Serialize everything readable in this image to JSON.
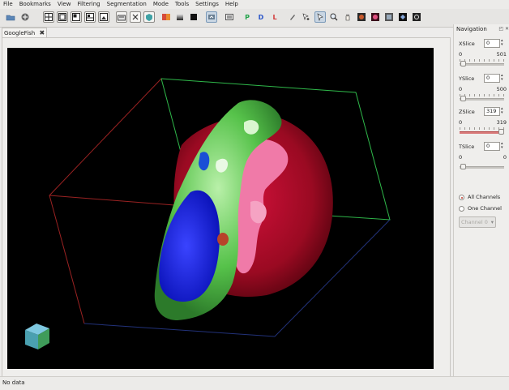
{
  "menu": [
    "File",
    "Bookmarks",
    "View",
    "Filtering",
    "Segmentation",
    "Mode",
    "Tools",
    "Settings",
    "Help"
  ],
  "toolbar": {
    "icons": [
      "open-icon",
      "save-icon",
      "layout-1-icon",
      "layout-2-icon",
      "layout-3-icon",
      "layout-4-icon",
      "screenshot-icon",
      "scissors-icon",
      "shield-icon",
      "color-icon",
      "gradient-icon",
      "black-square-icon",
      "view-3d-icon",
      "view-slice-icon",
      "p-icon",
      "d-icon",
      "l-icon",
      "pen-icon",
      "pointer-plus-icon",
      "pointer-icon",
      "zoom-icon",
      "hand-icon",
      "plugin-1-icon",
      "plugin-2-icon",
      "plugin-3-icon",
      "plugin-4-icon"
    ],
    "p_label": "P",
    "d_label": "D",
    "l_label": "L"
  },
  "tab": {
    "label": "GoogleFish",
    "close": "✖"
  },
  "navigation": {
    "title": "Navigation",
    "xslice": {
      "label": "XSlice",
      "value": "0",
      "min": "0",
      "max": "501"
    },
    "yslice": {
      "label": "YSlice",
      "value": "0",
      "min": "0",
      "max": "500"
    },
    "zslice": {
      "label": "ZSlice",
      "value": "319",
      "min": "0",
      "max": "319"
    },
    "tslice": {
      "label": "TSlice",
      "value": "0",
      "min": "0",
      "max": "0"
    },
    "all_channels": "All Channels",
    "one_channel": "One Channel",
    "channel_combo": "Channel 0"
  },
  "status": {
    "text": "No data"
  },
  "colors": {
    "accent": "#c0392b",
    "viewport_bg": "#000000"
  }
}
